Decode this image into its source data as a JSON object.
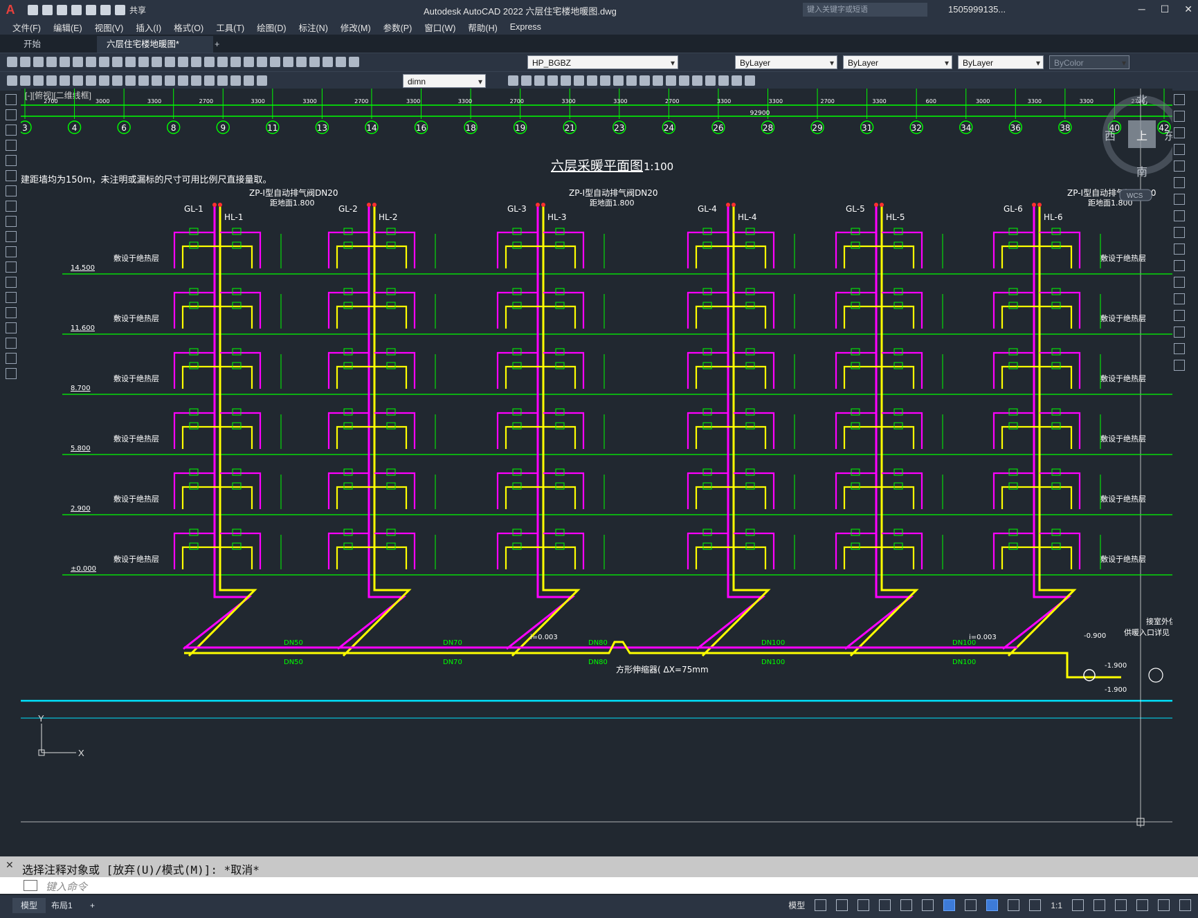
{
  "window": {
    "app_logo": "A",
    "title": "Autodesk AutoCAD 2022    六层住宅楼地暖图.dwg",
    "share_label": "共享",
    "search_placeholder": "键入关键字或短语",
    "user": "1505999135...",
    "controls": [
      "─",
      "☐",
      "✕"
    ]
  },
  "menu": [
    "文件(F)",
    "编辑(E)",
    "视图(V)",
    "插入(I)",
    "格式(O)",
    "工具(T)",
    "绘图(D)",
    "标注(N)",
    "修改(M)",
    "参数(P)",
    "窗口(W)",
    "帮助(H)",
    "Express"
  ],
  "tabs": [
    {
      "label": "开始"
    },
    {
      "label": "六层住宅楼地暖图*"
    },
    {
      "label": "+"
    }
  ],
  "toolbar": {
    "layer": "HP_BGBZ",
    "color": "ByLayer",
    "linetype": "ByLayer",
    "lineweight": "ByLayer",
    "plotstyle": "ByColor",
    "dimstyle": "dimn"
  },
  "viewport_label": "[-][俯视][二维线框]",
  "drawing": {
    "title": "六层采暖平面图",
    "scale": "1:100",
    "note": "建距墙均为150m，未注明或漏标的尺寸可用比例尺直接量取。",
    "grid_labels": [
      "3",
      "4",
      "6",
      "8",
      "9",
      "11",
      "13",
      "14",
      "16",
      "18",
      "19",
      "21",
      "23",
      "24",
      "26",
      "28",
      "29",
      "31",
      "32",
      "34",
      "36",
      "38",
      "40",
      "42"
    ],
    "dims": [
      "2700",
      "3000",
      "3300",
      "2700",
      "3300",
      "3300",
      "2700",
      "3300",
      "3300",
      "2700",
      "3300",
      "3300",
      "2700",
      "3300",
      "3300",
      "2700",
      "3300",
      "600",
      "3000",
      "3300",
      "3300",
      "2700"
    ],
    "total_dim": "92900",
    "levels": [
      "14.500",
      "11.600",
      "8.700",
      "5.800",
      "2.900",
      "±0.000"
    ],
    "level_note": "敷设于绝热层",
    "risers": [
      {
        "gl": "GL-1",
        "hl": "HL-1"
      },
      {
        "gl": "GL-2",
        "hl": "HL-2"
      },
      {
        "gl": "GL-3",
        "hl": "HL-3"
      },
      {
        "gl": "GL-4",
        "hl": "HL-4"
      },
      {
        "gl": "GL-5",
        "hl": "HL-5"
      },
      {
        "gl": "GL-6",
        "hl": "HL-6"
      }
    ],
    "valve_note": "ZP-Ⅰ型自动排气阀DN20",
    "valve_height": "距地面1.800",
    "mains": [
      "DN50",
      "DN70",
      "DN80",
      "DN100",
      "DN100"
    ],
    "slope": "i=0.003",
    "expansion": "方形伸缩器( ΔX=75mm",
    "outdoor": [
      "接室外供",
      "供暖入口详见"
    ],
    "out_levels": [
      "-0.900",
      "-1.900",
      "-1.900"
    ],
    "compass": {
      "n": "北",
      "s": "南",
      "e": "东",
      "w": "西",
      "center": "上",
      "wcs": "WCS"
    },
    "ucs": {
      "x": "X",
      "y": "Y"
    }
  },
  "command": {
    "history": "选择注释对象或 [放弃(U)/模式(M)]: *取消*",
    "placeholder": "键入命令"
  },
  "status": {
    "tabs": [
      "模型",
      "布局1",
      "+"
    ],
    "model_label": "模型",
    "scale": "1:1"
  },
  "colors": {
    "magenta": "#ff00ff",
    "yellow": "#ffff00",
    "green": "#00ff00",
    "cyan": "#00e5ff",
    "white": "#ffffff"
  }
}
